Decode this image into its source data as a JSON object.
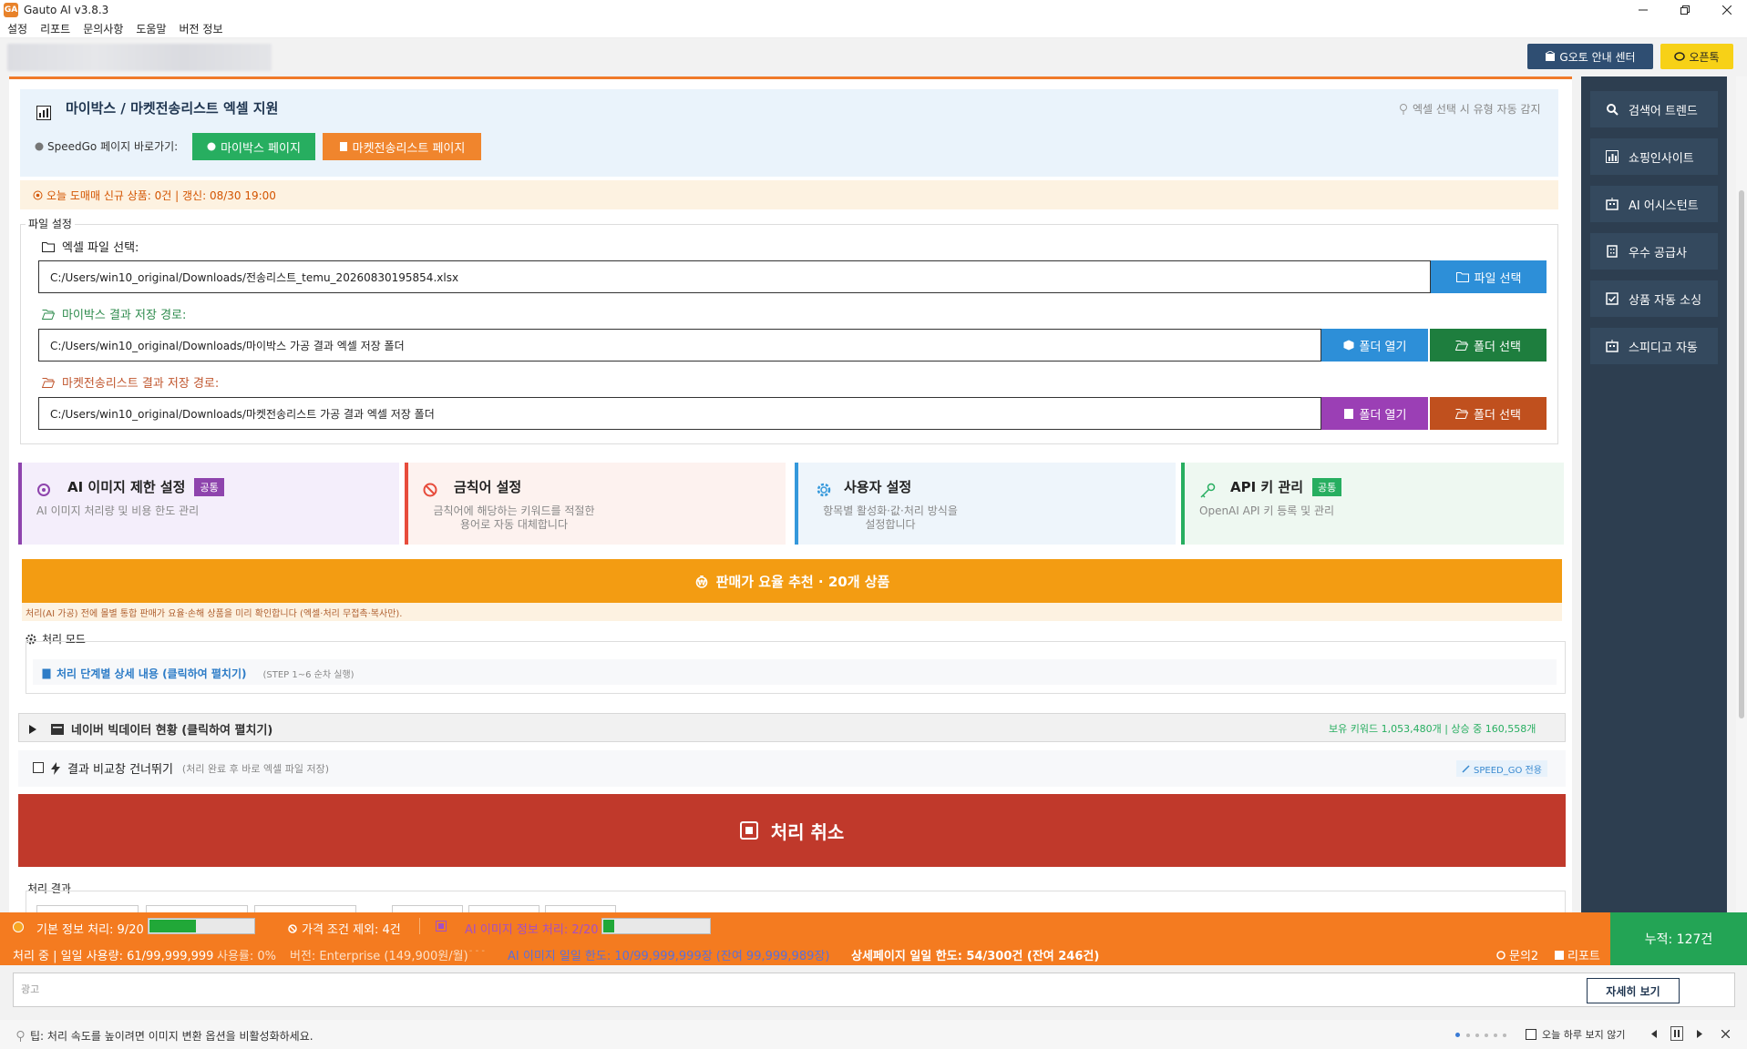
{
  "window": {
    "title": "Gauto AI v3.8.3",
    "logo_text": "GA"
  },
  "menu": [
    "설정",
    "리포트",
    "문의사항",
    "도움말",
    "버전 정보"
  ],
  "top_buttons": {
    "guide": "G오토 안내 센터",
    "openchat": "오픈톡"
  },
  "header": {
    "title": "마이박스 / 마켓전송리스트 엑셀 지원",
    "hint": "엑셀 선택 시 유형 자동 감지",
    "speedgo_label": "SpeedGo 페이지 바로가기:",
    "mybox_btn": "마이박스 페이지",
    "market_btn": "마켓전송리스트 페이지"
  },
  "notice": "오늘 도매매 신규 상품: 0건 | 갱신: 08/30 19:00",
  "file_settings": {
    "group_title": "파일 설정",
    "excel_label": "엑셀 파일 선택:",
    "excel_path": "C:/Users/win10_original/Downloads/전송리스트_temu_20260830195854.xlsx",
    "file_select_btn": "파일 선택",
    "mybox_label": "마이박스 결과 저장 경로:",
    "mybox_path": "C:/Users/win10_original/Downloads/마이박스 가공 결과 엑셀 저장 폴더",
    "market_label": "마켓전송리스트 결과 저장 경로:",
    "market_path": "C:/Users/win10_original/Downloads/마켓전송리스트 가공 결과 엑셀 저장 폴더",
    "open_folder_btn": "폴더 열기",
    "select_folder_btn": "폴더 선택"
  },
  "cards": [
    {
      "title": "AI 이미지 제한 설정",
      "badge": "공통",
      "desc1": "AI 이미지 처리량 및 비용 한도 관리",
      "desc2": "",
      "accent": "#8e44ad",
      "bg": "#f4eefb"
    },
    {
      "title": "금칙어 설정",
      "badge": "",
      "desc1": "금칙어에 해당하는 키워드를 적절한",
      "desc2": "용어로 자동 대체합니다",
      "accent": "#e74c3c",
      "bg": "#fdf2ef"
    },
    {
      "title": "사용자 설정",
      "badge": "",
      "desc1": "항목별 활성화·값·처리 방식을",
      "desc2": "설정합니다",
      "accent": "#3498db",
      "bg": "#eef5fb"
    },
    {
      "title": "API 키 관리",
      "badge": "공통",
      "desc1": "OpenAI API 키 등록 및 관리",
      "desc2": "",
      "accent": "#27ae60",
      "bg": "#eef8f1"
    }
  ],
  "recommend_bar": "판매가 요율 추천 · 20개 상품",
  "recommend_note": "처리(AI 가공) 전에 몰별 통합 판매가 요율·손해 상품을 미리 확인합니다 (엑셀·처리 무접촉·복사만).",
  "mode": {
    "title": "처리 모드",
    "detail_link": "처리 단계별 상세 내용 (클릭하여 펼치기)",
    "detail_hint": "(STEP 1~6 순차 실행)"
  },
  "naver": {
    "title": "네이버 빅데이터 현황 (클릭하여 펼치기)",
    "stats": "보유 키워드 1,053,480개 | 상승 중 160,558개"
  },
  "skip": {
    "label": "결과 비교창 건너뛰기",
    "hint": "(처리 완료 후 바로 엑셀 파일 저장)",
    "tag": "SPEED_GO 전용"
  },
  "cancel_btn": "처리 취소",
  "results_title": "처리 결과",
  "status": {
    "basic": "기본 정보 처리: 9/20",
    "basic_progress": 0.45,
    "price_excluded": "가격 조건 제외: 4건",
    "ai_image": "AI 이미지 정보 처리: 2/20",
    "ai_progress": 0.1,
    "line2_a": "처리 중 | 일일 사용량: 61/99,999,999",
    "line2_b": "사용률: 0%",
    "line2_c": "버전: Enterprise (149,900원/월)",
    "line2_d": "AI 이미지 일일 한도: 10/99,999,999장 (잔여 99,999,989장)",
    "line2_e": "상세페이지 일일 한도: 54/300건 (잔여 246건)",
    "inquiry": "문의2",
    "report": "리포트",
    "cumulative": "누적: 127건"
  },
  "ad": {
    "label": "광고",
    "detail_btn": "자세히 보기"
  },
  "tip": {
    "text": "팁: 처리 속도를 높이려면 이미지 변환 옵션을 비활성화하세요.",
    "hide_today": "오늘 하루 보지 않기"
  },
  "sidebar": [
    "검색어 트렌드",
    "쇼핑인사이트",
    "AI 어시스턴트",
    "우수 공급사",
    "상품 자동 소싱",
    "스피디고 자동"
  ],
  "colors": {
    "orange": "#f47b20",
    "sidebar": "#2d3e50",
    "cancel": "#c0392b",
    "recommend": "#f39c12"
  }
}
